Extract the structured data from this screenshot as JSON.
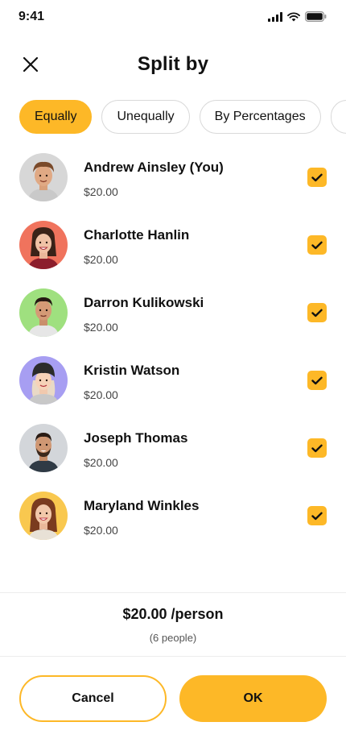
{
  "status_bar": {
    "time": "9:41"
  },
  "header": {
    "title": "Split by"
  },
  "tabs": [
    {
      "label": "Equally",
      "active": true
    },
    {
      "label": "Unequally",
      "active": false
    },
    {
      "label": "By Percentages",
      "active": false
    },
    {
      "label": "",
      "active": false
    }
  ],
  "people": [
    {
      "name": "Andrew Ainsley (You)",
      "amount": "$20.00",
      "checked": true,
      "avatar_bg": "#d7d7d7"
    },
    {
      "name": "Charlotte Hanlin",
      "amount": "$20.00",
      "checked": true,
      "avatar_bg": "#f0735d"
    },
    {
      "name": "Darron Kulikowski",
      "amount": "$20.00",
      "checked": true,
      "avatar_bg": "#9fe07f"
    },
    {
      "name": "Kristin Watson",
      "amount": "$20.00",
      "checked": true,
      "avatar_bg": "#a79ef2"
    },
    {
      "name": "Joseph Thomas",
      "amount": "$20.00",
      "checked": true,
      "avatar_bg": "#d3d6da"
    },
    {
      "name": "Maryland Winkles",
      "amount": "$20.00",
      "checked": true,
      "avatar_bg": "#f9c84f"
    }
  ],
  "summary": {
    "amount_per_person": "$20.00 /person",
    "people_count": "(6 people)"
  },
  "actions": {
    "cancel_label": "Cancel",
    "ok_label": "OK"
  },
  "colors": {
    "accent": "#FDB827",
    "text": "#111111",
    "muted": "#555555"
  }
}
